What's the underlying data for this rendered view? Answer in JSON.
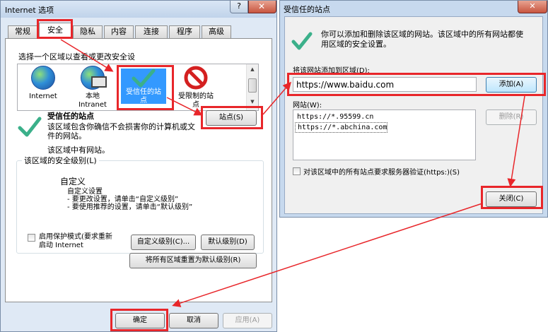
{
  "left_dialog": {
    "title": "Internet 选项",
    "help_label": "?",
    "tabs": [
      "常规",
      "安全",
      "隐私",
      "内容",
      "连接",
      "程序",
      "高级"
    ],
    "zones_caption": "选择一个区域以查看或更改安全设",
    "zones": [
      {
        "label": "Internet"
      },
      {
        "label": "本地\nIntranet"
      },
      {
        "label": "受信任的站\n点"
      },
      {
        "label": "受限制的站\n点"
      }
    ],
    "sites_button": "站点(S)",
    "zone_name": "受信任的站点",
    "zone_desc": "该区域包含你确信不会损害你的计算机或文\n件的网站。",
    "zone_note": "该区域中有网站。",
    "security_level_title": "该区域的安全级别(L)",
    "level_name": "自定义",
    "level_desc": "自定义设置\n- 要更改设置，请单击“自定义级别”\n- 要使用推荐的设置，请单击“默认级别”",
    "protected_mode_label": "启用保护模式(要求重新\n启动 Internet",
    "custom_level_button": "自定义级别(C)...",
    "default_level_button": "默认级别(D)",
    "reset_all_button": "将所有区域重置为默认级别(R)",
    "ok_button": "确定",
    "cancel_button": "取消",
    "apply_button": "应用(A)"
  },
  "right_dialog": {
    "title": "受信任的站点",
    "close_glyph": "✕",
    "info": "你可以添加和删除该区域的网站。该区域中的所有网站都使\n用区域的安全设置。",
    "add_label": "将该网站添加到区域(D):",
    "add_value": "https://www.baidu.com",
    "add_button": "添加(A)",
    "websites_label": "网站(W):",
    "websites": [
      "https://*.95599.cn",
      "https://*.abchina.com"
    ],
    "remove_button": "删除(R)",
    "require_https_label": "对该区域中的所有站点要求服务器验证(https:)(S)",
    "close_button": "关闭(C)"
  },
  "colors": {
    "highlight": "#e8262a",
    "selection": "#3399ff",
    "title_bar": "#c7d9ee"
  }
}
